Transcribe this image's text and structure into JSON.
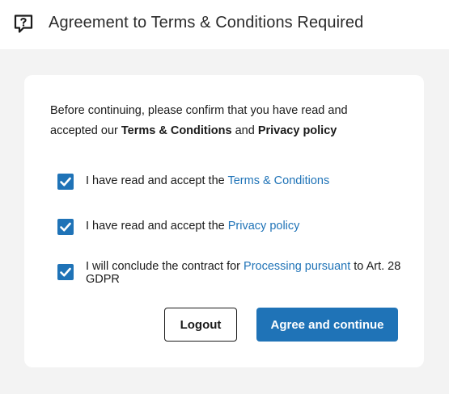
{
  "header": {
    "title": "Agreement to Terms & Conditions Required",
    "icon": "speech-bubble-question-icon"
  },
  "intro": {
    "text_before": "Before continuing, please confirm that you have read and accepted our ",
    "terms_bold": "Terms & Conditions",
    "and_text": " and ",
    "privacy_bold": "Privacy policy"
  },
  "checkboxes": [
    {
      "checked": true,
      "text": "I have read and accept the ",
      "link": "Terms & Conditions",
      "after": ""
    },
    {
      "checked": true,
      "text": "I have read and accept the ",
      "link": "Privacy policy",
      "after": ""
    },
    {
      "checked": true,
      "text": "I will conclude the contract for ",
      "link": "Processing pursuant",
      "after": " to Art. 28 GDPR"
    }
  ],
  "buttons": {
    "logout_label": "Logout",
    "agree_label": "Agree and continue"
  },
  "colors": {
    "accent": "#1f73b7",
    "background": "#f3f3f3",
    "card": "#ffffff"
  }
}
